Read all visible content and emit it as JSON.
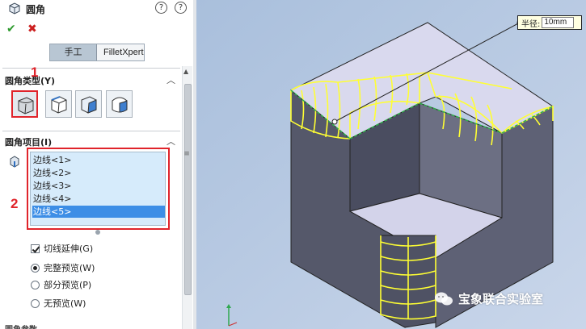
{
  "header": {
    "title": "圆角",
    "help_glyph": "?",
    "help2_glyph": "?"
  },
  "actions": {
    "ok_glyph": "✔",
    "cancel_glyph": "✖"
  },
  "mode_tabs": {
    "manual": "手工",
    "filletxpert": "FilletXpert",
    "active": "manual"
  },
  "fillet_type": {
    "title": "圆角类型(Y)",
    "options": [
      "constant-radius",
      "variable-radius",
      "face-fillet",
      "full-round"
    ],
    "selected": 0
  },
  "fillet_items": {
    "title": "圆角项目(I)",
    "edges": [
      "边线<1>",
      "边线<2>",
      "边线<3>",
      "边线<4>",
      "边线<5>"
    ],
    "selected_index": 4
  },
  "options": {
    "tangent_propagation": "切线延伸(G)",
    "tangent_checked": true,
    "preview": [
      {
        "label": "完整预览(W)",
        "selected": true
      },
      {
        "label": "部分预览(P)",
        "selected": false
      },
      {
        "label": "无预览(W)",
        "selected": false
      }
    ]
  },
  "annotations": {
    "marker1": "1",
    "marker2": "2"
  },
  "next_section": "圆角参数",
  "viewport": {
    "radius_label": "半径:",
    "radius_value": "10mm",
    "watermark": "宝象联合实验室"
  },
  "colors": {
    "accent_red": "#e0242b",
    "selection_blue": "#3d8ee6",
    "list_bg": "#d6ebfb",
    "preview_yellow": "#ffff33",
    "viewport_bg": "#b9cbe4"
  }
}
